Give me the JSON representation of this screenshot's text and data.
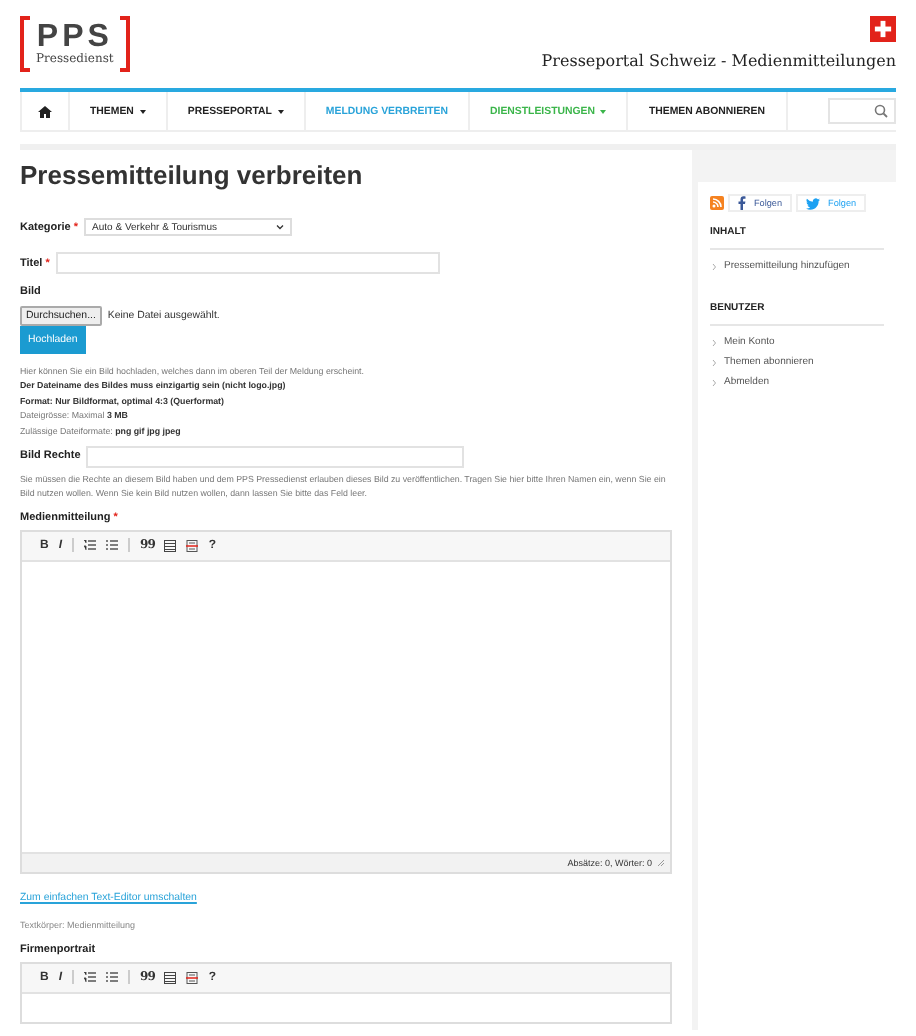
{
  "header": {
    "logo_mark": "PPS",
    "logo_subtitle": "Pressedienst",
    "tagline": "Presseportal Schweiz - Medienmitteilungen"
  },
  "nav": {
    "items": [
      {
        "kind": "home"
      },
      {
        "kind": "text",
        "label": "THEMEN",
        "dropdown": true,
        "color": "#222222"
      },
      {
        "kind": "text",
        "label": "PRESSEPORTAL",
        "dropdown": true,
        "color": "#222222"
      },
      {
        "kind": "text",
        "label": "MELDUNG VERBREITEN",
        "dropdown": false,
        "color": "#29a3d9"
      },
      {
        "kind": "text",
        "label": "DIENSTLEISTUNGEN",
        "dropdown": true,
        "color": "#3bb54a"
      },
      {
        "kind": "text",
        "label": "THEMEN ABONNIEREN",
        "dropdown": false,
        "color": "#222222"
      }
    ]
  },
  "page_title": "Pressemitteilung verbreiten",
  "form": {
    "category": {
      "label": "Kategorie",
      "required_mark": "*",
      "value": "Auto & Verkehr & Tourismus"
    },
    "title": {
      "label": "Titel",
      "required_mark": "*"
    },
    "image": {
      "label": "Bild",
      "browse_button": "Durchsuchen...",
      "file_status": "Keine Datei ausgewählt.",
      "upload_button": "Hochladen",
      "help": [
        {
          "text": "Hier können Sie ein Bild hochladen, welches dann im oberen Teil der Meldung erscheint.",
          "bold": false
        },
        {
          "text": "Der Dateiname des Bildes muss einzigartig sein (nicht logo.jpg)",
          "bold": true
        },
        {
          "text": "Format: Nur Bildformat, optimal 4:3 (Querformat)",
          "bold": true
        },
        {
          "text": "Dateigrösse: Maximal **3 MB**",
          "bold": false
        },
        {
          "text": "Zulässige Dateiformate: **png gif jpg jpeg**",
          "bold": false
        }
      ]
    },
    "image_rights": {
      "label": "Bild Rechte",
      "help": "Sie müssen die Rechte an diesem Bild haben und dem PPS Pressedienst erlauben dieses Bild zu veröffentlichen. Tragen Sie hier bitte Ihren Namen ein, wenn Sie ein Bild nutzen wollen. Wenn Sie kein Bild nutzen wollen, dann lassen Sie bitte das Feld leer."
    },
    "editors": [
      {
        "label": "Medienmitteilung",
        "required_mark": "*",
        "status": "Absätze: 0, Wörter: 0",
        "switch_link": "Zum einfachen Text-Editor umschalten",
        "hint": "Textkörper: Medienmitteilung",
        "toolbar": [
          {
            "kind": "bold",
            "label": "B"
          },
          {
            "kind": "italic",
            "label": "I"
          },
          {
            "kind": "sep"
          },
          {
            "kind": "ol"
          },
          {
            "kind": "ul"
          },
          {
            "kind": "sep"
          },
          {
            "kind": "quote",
            "label": "99"
          },
          {
            "kind": "table"
          },
          {
            "kind": "strike"
          },
          {
            "kind": "help",
            "label": "?"
          }
        ]
      },
      {
        "label": "Firmenportrait",
        "toolbar": [
          {
            "kind": "bold",
            "label": "B"
          },
          {
            "kind": "italic",
            "label": "I"
          },
          {
            "kind": "sep"
          },
          {
            "kind": "ol"
          },
          {
            "kind": "ul"
          },
          {
            "kind": "sep"
          },
          {
            "kind": "quote",
            "label": "99"
          },
          {
            "kind": "table"
          },
          {
            "kind": "strike"
          },
          {
            "kind": "help",
            "label": "?"
          }
        ]
      }
    ]
  },
  "sidebar": {
    "social": [
      {
        "kind": "rss"
      },
      {
        "kind": "facebook",
        "label": "Folgen"
      },
      {
        "kind": "twitter",
        "label": "Folgen"
      }
    ],
    "sections": [
      {
        "title": "INHALT",
        "items": [
          "Pressemitteilung hinzufügen"
        ]
      },
      {
        "title": "BENUTZER",
        "items": [
          "Mein Konto",
          "Themen abonnieren",
          "Abmelden"
        ]
      }
    ]
  }
}
